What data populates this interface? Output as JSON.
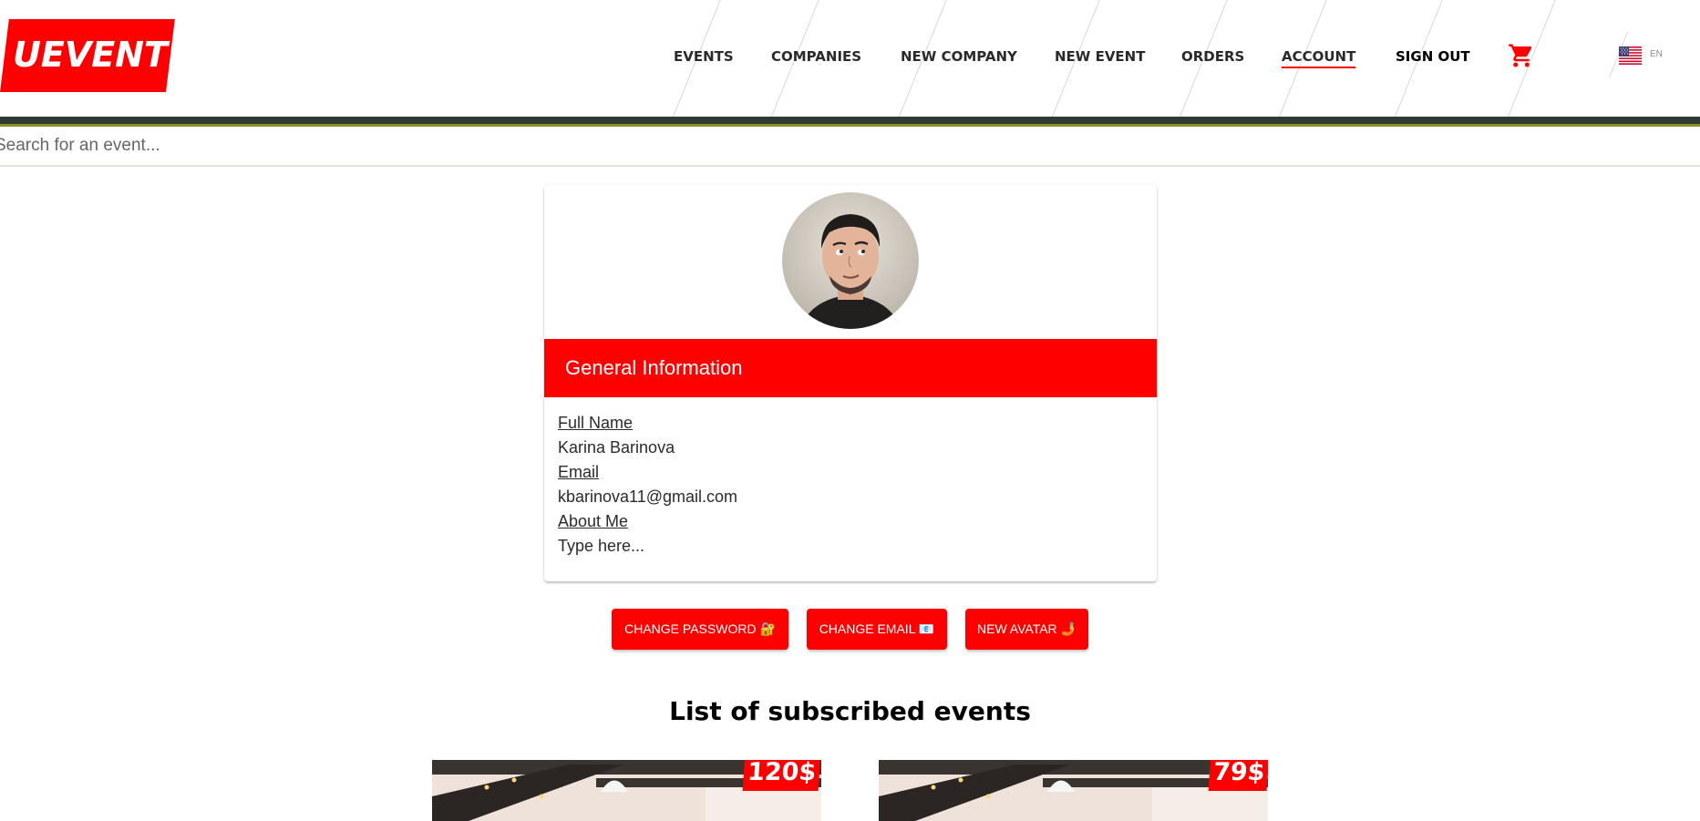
{
  "header": {
    "logo": "UEVENT",
    "nav": [
      "EVENTS",
      "COMPANIES",
      "NEW COMPANY",
      "NEW EVENT",
      "ORDERS",
      "ACCOUNT",
      "SIGN OUT"
    ],
    "active_nav": "ACCOUNT",
    "language": "EN",
    "cart_icon": "cart-icon",
    "flag_icon": "us-flag-icon"
  },
  "search": {
    "placeholder": "Search for an event..."
  },
  "profile": {
    "section_title": "General Information",
    "full_name_label": "Full Name",
    "full_name": "Karina Barinova",
    "email_label": "Email",
    "email": "kbarinova11@gmail.com",
    "about_label": "About Me",
    "about": "Type here..."
  },
  "actions": {
    "change_password": "CHANGE PASSWORD 🔐",
    "change_email": "CHANGE EMAIL 📧",
    "new_avatar": "NEW AVATAR 🤳"
  },
  "events": {
    "title": "List of subscribed events",
    "items": [
      {
        "price": "120$"
      },
      {
        "price": "79$"
      }
    ]
  },
  "colors": {
    "brand": "#ff0000",
    "header_bar": "#2f3a34"
  }
}
